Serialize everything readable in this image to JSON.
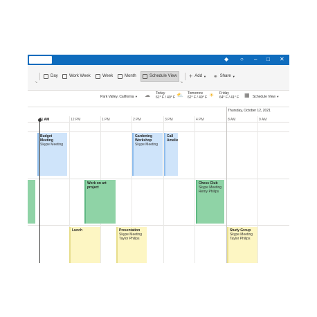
{
  "ribbon": {
    "day": "Day",
    "work_week": "Work Week",
    "week": "Week",
    "month": "Month",
    "schedule_view": "Schedule View",
    "add": "Add",
    "share": "Share",
    "schedule_view_dd": "Schedule View"
  },
  "location": "Park Valley, California",
  "weather": [
    {
      "label": "Today",
      "temp": "61° F / 40° F",
      "icon": "cloud-icon"
    },
    {
      "label": "Tomorrow",
      "temp": "62° F / 49° F",
      "icon": "partly-cloudy-icon"
    },
    {
      "label": "Friday",
      "temp": "64° F / 41° F",
      "icon": "sun-icon"
    }
  ],
  "date_header": "Thursday, October 12, 2021",
  "times": [
    "11 AM",
    "12 PM",
    "1 PM",
    "2 PM",
    "3 PM",
    "4 PM",
    "8 AM",
    "9 AM"
  ],
  "events": [
    {
      "title": "Budget Meeting",
      "lines": [
        "Skype Meeting"
      ]
    },
    {
      "title": "Gardening Workshop",
      "lines": [
        "Skype Meeting"
      ]
    },
    {
      "title": "Call Amelie",
      "lines": []
    },
    {
      "title": "",
      "lines": []
    },
    {
      "title": "Work on art project",
      "lines": []
    },
    {
      "title": "Chess Club",
      "lines": [
        "Skype Meeting",
        "Remy Philips"
      ]
    },
    {
      "title": "Lunch",
      "lines": []
    },
    {
      "title": "Presentation",
      "lines": [
        "Skype Meeting",
        "Taylor Philips"
      ]
    },
    {
      "title": "Study Group",
      "lines": [
        "Skype Meeting",
        "Taylor Philips"
      ]
    }
  ],
  "colors": {
    "accent": "#0f6cbd",
    "event_blue": "#cfe4fa",
    "event_green": "#8fd3a6",
    "event_yellow": "#fdf6c3"
  }
}
